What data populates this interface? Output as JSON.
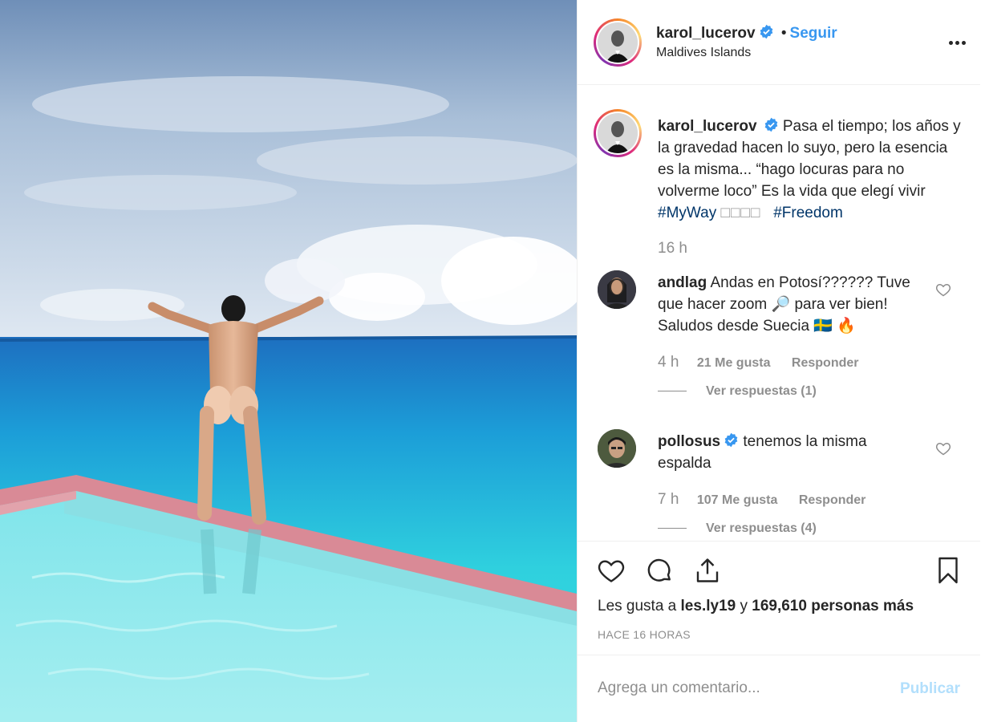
{
  "post": {
    "username": "karol_lucerov",
    "follow_label": "Seguir",
    "separator": "•",
    "location": "Maldives Islands",
    "more_icon": "more-options-icon"
  },
  "caption": {
    "username": "karol_lucerov",
    "text": "Pasa el tiempo; los años y la gravedad hacen lo suyo, pero la esencia es la misma... “hago locuras para no volverme loco” Es la vida que elegí vivir",
    "hashtag1": "#MyWay",
    "emoji_boxes": "□□□□",
    "hashtag2": "#Freedom",
    "time": "16 h"
  },
  "comments": [
    {
      "username": "andlag",
      "text": "Andas en Potosí?????? Tuve que hacer zoom 🔎 para ver bien! Saludos desde Suecia 🇸🇪 🔥",
      "time": "4 h",
      "likes": "21 Me gusta",
      "reply": "Responder",
      "view_replies": "Ver respuestas (1)"
    },
    {
      "username": "pollosus",
      "text": "tenemos la misma espalda",
      "time": "7 h",
      "likes": "107 Me gusta",
      "reply": "Responder",
      "view_replies": "Ver respuestas (4)"
    }
  ],
  "likes_line": {
    "prefix": "Les gusta a",
    "user": "les.ly19",
    "middle": "y",
    "count": "169,610 personas más"
  },
  "timestamp": "HACE 16 HORAS",
  "comment_form": {
    "placeholder": "Agrega un comentario...",
    "publish_label": "Publicar"
  },
  "colors": {
    "link_blue": "#3897f0",
    "hashtag_blue": "#003569",
    "muted": "#8e8e8e",
    "publish_disabled": "#b2dffc"
  }
}
